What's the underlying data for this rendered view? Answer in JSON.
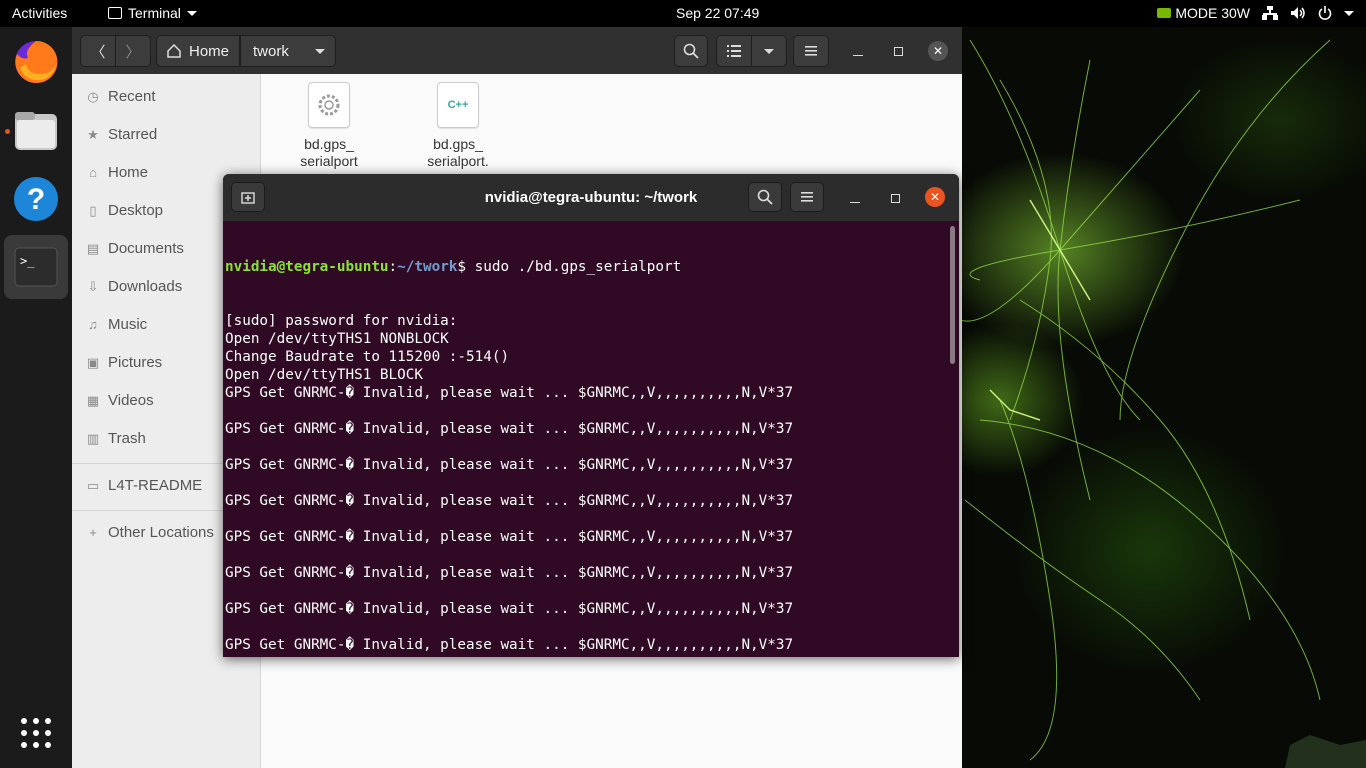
{
  "topbar": {
    "activities": "Activities",
    "app_name": "Terminal",
    "clock": "Sep 22  07:49",
    "power_mode": "MODE 30W"
  },
  "dock": {
    "items": [
      "firefox",
      "files",
      "help",
      "terminal"
    ],
    "show_apps": "show-applications"
  },
  "files": {
    "path": [
      "Home",
      "twork"
    ],
    "sidebar": [
      {
        "label": "Recent",
        "icon": "clock-icon"
      },
      {
        "label": "Starred",
        "icon": "star-icon"
      },
      {
        "label": "Home",
        "icon": "home-icon"
      },
      {
        "label": "Desktop",
        "icon": "desktop-icon"
      },
      {
        "label": "Documents",
        "icon": "document-icon"
      },
      {
        "label": "Downloads",
        "icon": "download-icon"
      },
      {
        "label": "Music",
        "icon": "music-icon"
      },
      {
        "label": "Pictures",
        "icon": "picture-icon"
      },
      {
        "label": "Videos",
        "icon": "video-icon"
      },
      {
        "label": "Trash",
        "icon": "trash-icon"
      }
    ],
    "device": "L4T-README",
    "other_locations": "Other Locations",
    "items": [
      {
        "name": "bd.gps_\nserialport",
        "icon": "executable-gear-icon"
      },
      {
        "name": "bd.gps_\nserialport.\ncpp",
        "icon": "cpp-file-icon",
        "icon_text": "C++"
      }
    ]
  },
  "terminal": {
    "title": "nvidia@tegra-ubuntu: ~/twork",
    "prompt_user": "nvidia@tegra-ubuntu",
    "prompt_path": "~/twork",
    "command": "$ sudo ./bd.gps_serialport",
    "lines": [
      "[sudo] password for nvidia:",
      "Open /dev/ttyTHS1 NONBLOCK",
      "Change Baudrate to 115200 :-514()",
      "Open /dev/ttyTHS1 BLOCK",
      "GPS Get GNRMC-� Invalid, please wait ... $GNRMC,,V,,,,,,,,,,N,V*37",
      "",
      "GPS Get GNRMC-� Invalid, please wait ... $GNRMC,,V,,,,,,,,,,N,V*37",
      "",
      "GPS Get GNRMC-� Invalid, please wait ... $GNRMC,,V,,,,,,,,,,N,V*37",
      "",
      "GPS Get GNRMC-� Invalid, please wait ... $GNRMC,,V,,,,,,,,,,N,V*37",
      "",
      "GPS Get GNRMC-� Invalid, please wait ... $GNRMC,,V,,,,,,,,,,N,V*37",
      "",
      "GPS Get GNRMC-� Invalid, please wait ... $GNRMC,,V,,,,,,,,,,N,V*37",
      "",
      "GPS Get GNRMC-� Invalid, please wait ... $GNRMC,,V,,,,,,,,,,N,V*37",
      "",
      "GPS Get GNRMC-� Invalid, please wait ... $GNRMC,,V,,,,,,,,,,N,V*37",
      "",
      "GPS Get GNRMC-� Invalid, please wait ... $GNRMC,,V,,,,,,,,,,N,V*37",
      "",
      "GPS Get GNRMC-� Invalid, please wait ... $GNRMC,,V,,,,,,,,,,N,V*37"
    ]
  }
}
